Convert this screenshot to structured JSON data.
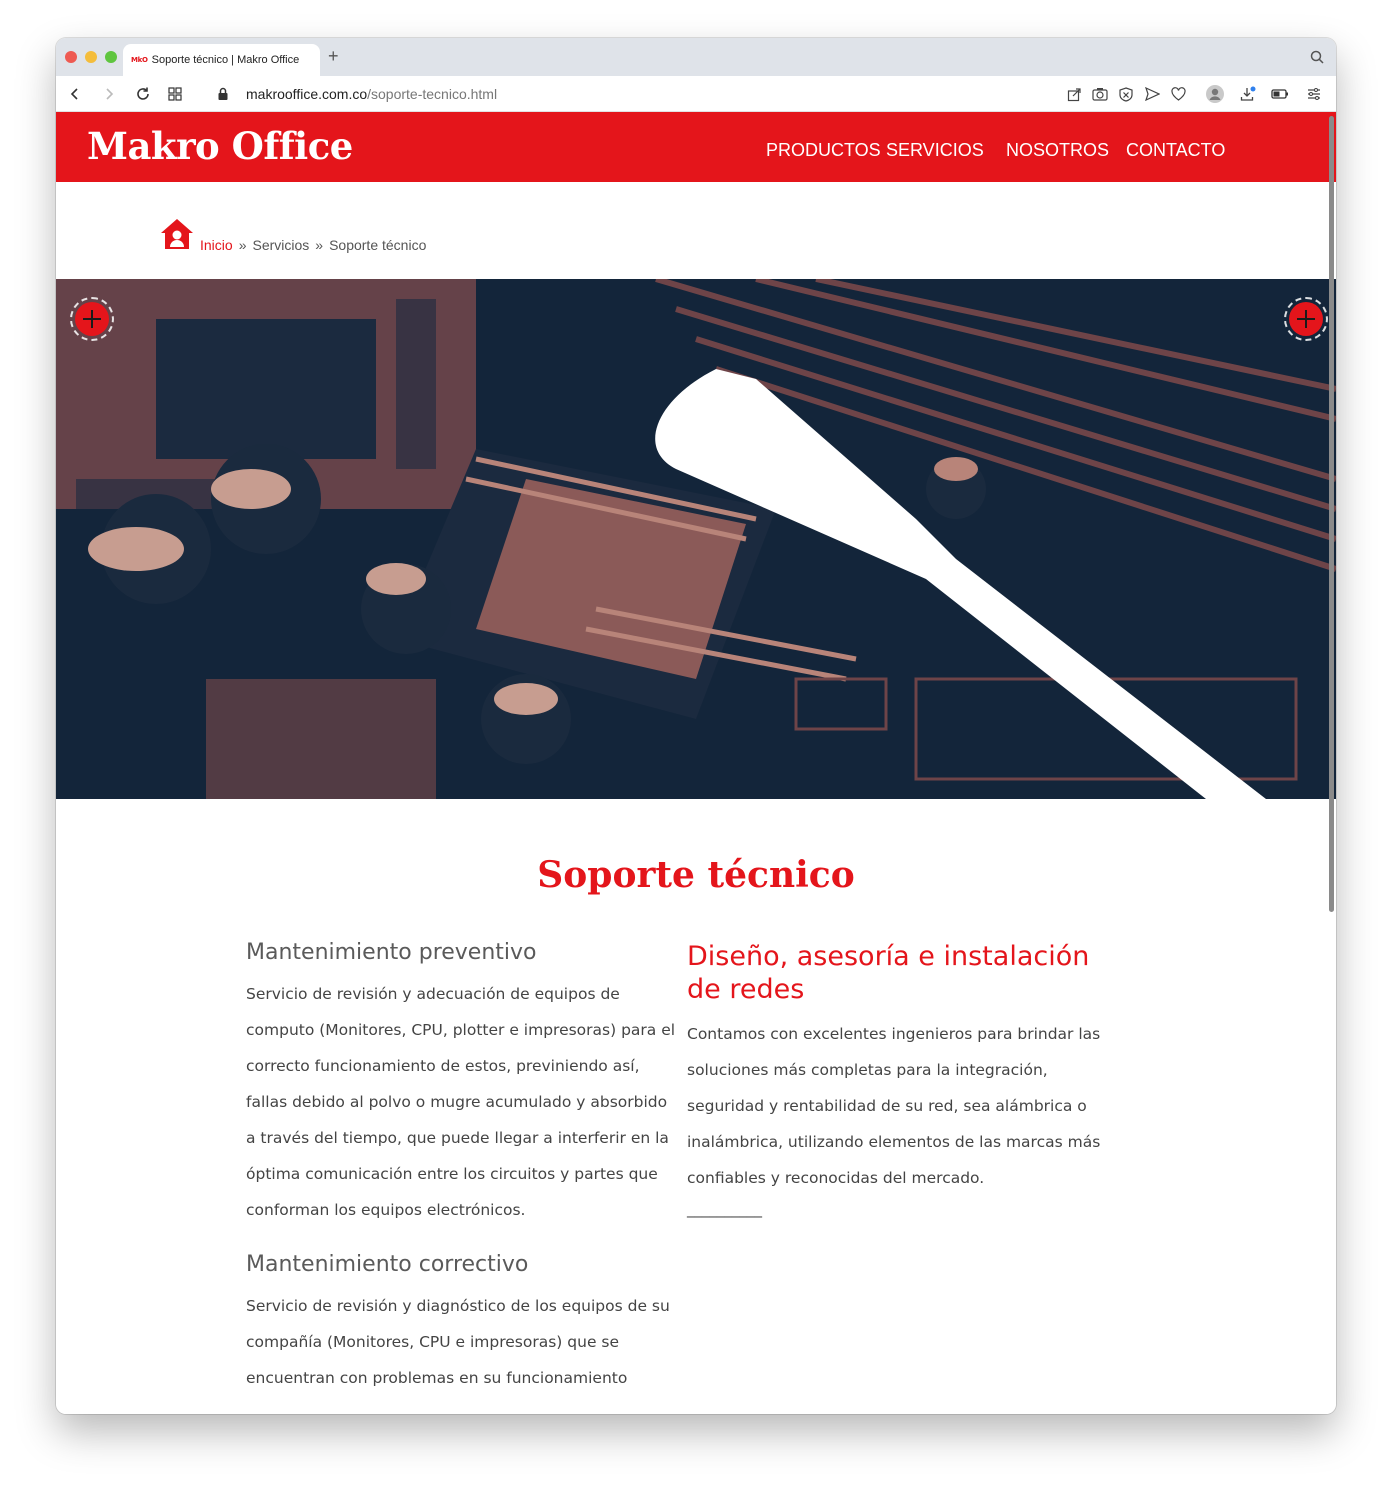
{
  "browser": {
    "tab_favicon": "MkO",
    "tab_title": "Soporte técnico | Makro Office",
    "new_tab": "+",
    "url_domain": "makrooffice.com.co",
    "url_path": "/soporte-tecnico.html"
  },
  "site": {
    "logo": "Makro Office",
    "nav": {
      "productos": "PRODUCTOS",
      "servicios": "SERVICIOS",
      "nosotros": "NOSOTROS",
      "contacto": "CONTACTO"
    },
    "brand_color": "#e4151b"
  },
  "breadcrumb": {
    "home": "Inicio",
    "separator": "»",
    "items": [
      "Servicios",
      "Soporte técnico"
    ]
  },
  "page": {
    "title": "Soporte técnico",
    "left": {
      "heading1": "Mantenimiento preventivo",
      "text1": "Servicio de revisión y adecuación de equipos de computo (Monitores, CPU, plotter e impresoras) para el correcto funcionamiento de estos, previniendo así, fallas debido al polvo o mugre acumulado y absorbido a través del tiempo, que puede llegar a interferir en la óptima comunicación entre los circuitos y partes que conforman los equipos electrónicos.",
      "heading2": "Mantenimiento correctivo",
      "text2": "Servicio de revisión y diagnóstico de los equipos de su compañía (Monitores, CPU e impresoras) que se encuentran con problemas en su funcionamiento"
    },
    "right": {
      "heading": "Diseño, asesoría e instalación de redes",
      "text": "Contamos con excelentes ingenieros para brindar las soluciones más completas para la integración, seguridad y rentabilidad de su red, sea alámbrica o inalámbrica, utilizando elementos de las marcas más confiables y reconocidas del mercado.",
      "underline": "__________"
    }
  },
  "icons": {
    "home": "house-icon",
    "slider_prev": "crosshair-prev-icon",
    "slider_next": "crosshair-next-icon"
  }
}
